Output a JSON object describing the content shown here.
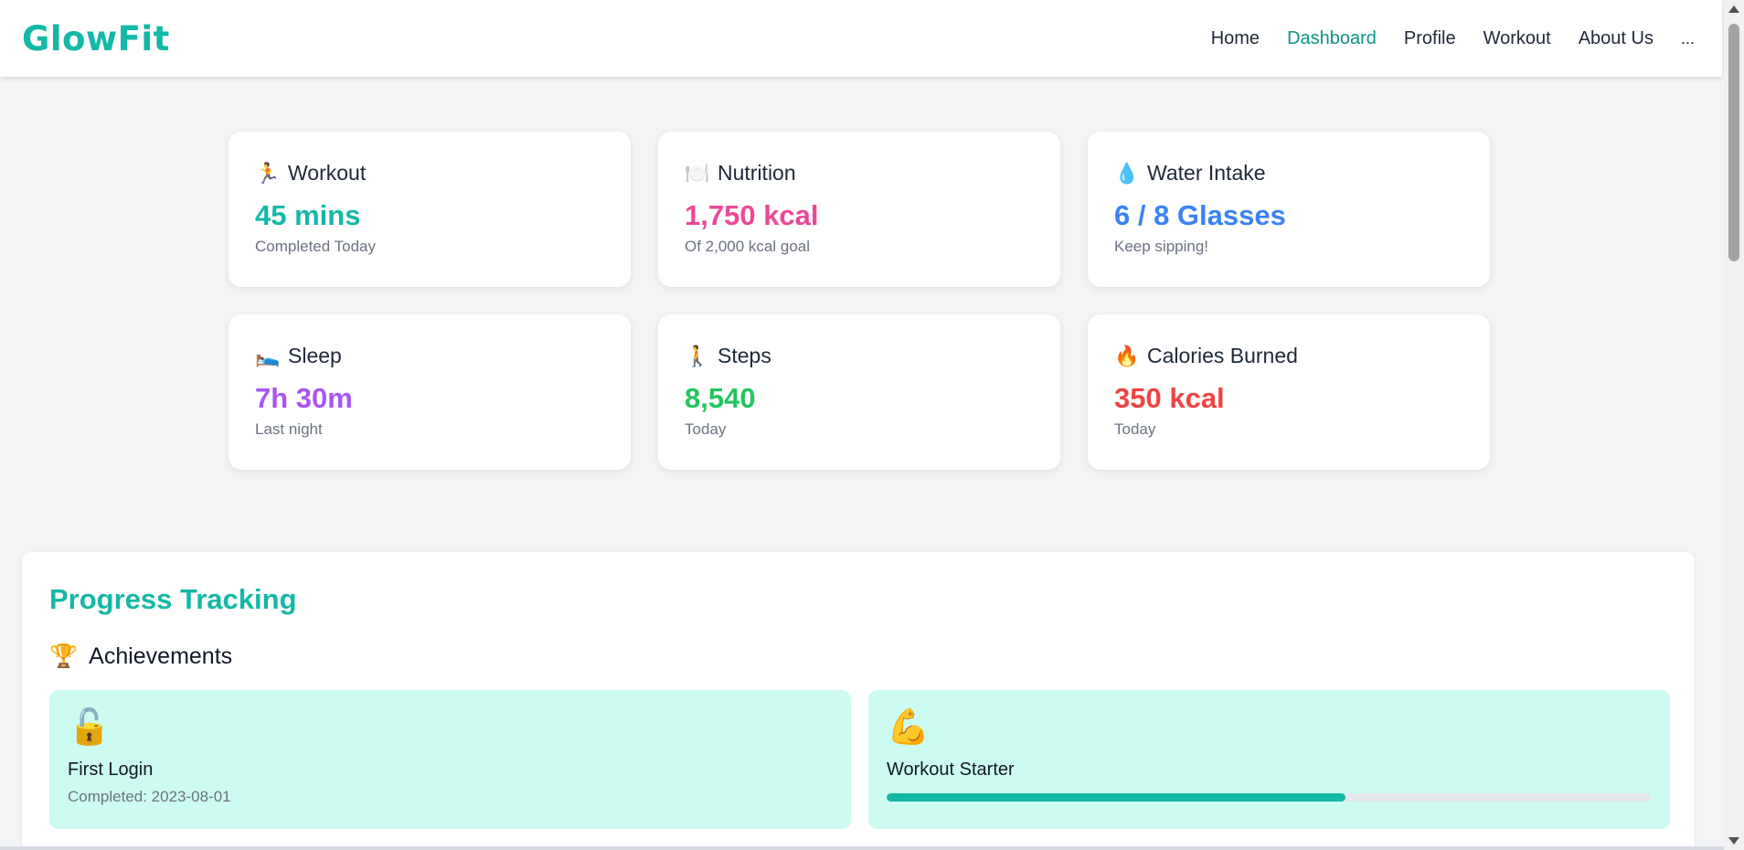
{
  "app": {
    "logo": "GlowFit"
  },
  "nav": {
    "items": [
      {
        "label": "Home",
        "active": false
      },
      {
        "label": "Dashboard",
        "active": true
      },
      {
        "label": "Profile",
        "active": false
      },
      {
        "label": "Workout",
        "active": false
      },
      {
        "label": "About Us",
        "active": false
      }
    ],
    "more": "..."
  },
  "cards": [
    {
      "icon": "🏃",
      "icon_name": "runner-icon",
      "title": "Workout",
      "value": "45 mins",
      "sub": "Completed Today",
      "color": "#14b8a6"
    },
    {
      "icon": "🍽️",
      "icon_name": "plate-icon",
      "title": "Nutrition",
      "value": "1,750 kcal",
      "sub": "Of 2,000 kcal goal",
      "color": "#ec4899"
    },
    {
      "icon": "💧",
      "icon_name": "droplet-icon",
      "title": "Water Intake",
      "value": "6 / 8 Glasses",
      "sub": "Keep sipping!",
      "color": "#3b82f6"
    },
    {
      "icon": "🛌",
      "icon_name": "bed-icon",
      "title": "Sleep",
      "value": "7h 30m",
      "sub": "Last night",
      "color": "#a855f7"
    },
    {
      "icon": "🚶",
      "icon_name": "walker-icon",
      "title": "Steps",
      "value": "8,540",
      "sub": "Today",
      "color": "#22c55e"
    },
    {
      "icon": "🔥",
      "icon_name": "fire-icon",
      "title": "Calories Burned",
      "value": "350 kcal",
      "sub": "Today",
      "color": "#ef4444"
    }
  ],
  "progress": {
    "title": "Progress Tracking",
    "achievements": {
      "icon": "🏆",
      "icon_name": "trophy-icon",
      "title": "Achievements",
      "items": [
        {
          "icon": "🔓",
          "icon_name": "unlock-icon",
          "title": "First Login",
          "sub": "Completed: 2023-08-01"
        },
        {
          "icon": "💪",
          "icon_name": "flexed-biceps-icon",
          "title": "Workout Starter",
          "progress": 0.6
        }
      ]
    }
  }
}
